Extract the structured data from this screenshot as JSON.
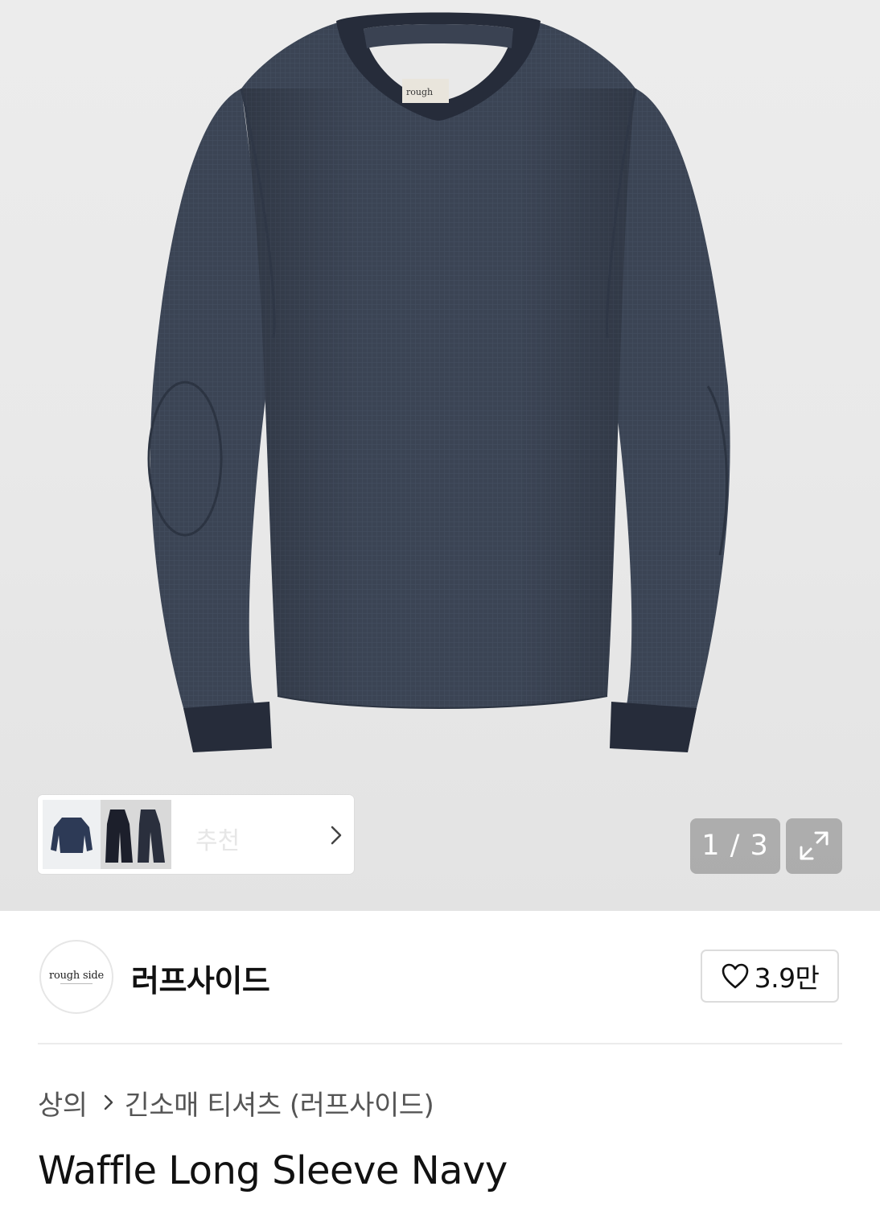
{
  "gallery": {
    "current_page": "1",
    "total_pages": "3",
    "counter_text": "1 / 3",
    "garment_color": "#3b4454",
    "thumbnails": [
      {
        "color": "#2d3a56",
        "label": "navy-tee-thumb"
      },
      {
        "color": "#1c1f2b",
        "label": "black-tee-thumb-a"
      },
      {
        "color": "#2a2f3d",
        "label": "black-tee-thumb-b"
      }
    ],
    "thumbnail_ghost_text": "추천"
  },
  "brand": {
    "logo_text": "rough side",
    "name": "러프사이드",
    "like_count": "3.9만"
  },
  "breadcrumb": {
    "category": "상의",
    "subcategory": "긴소매 티셔츠 (러프사이드)"
  },
  "product": {
    "title": "Waffle Long Sleeve Navy"
  }
}
